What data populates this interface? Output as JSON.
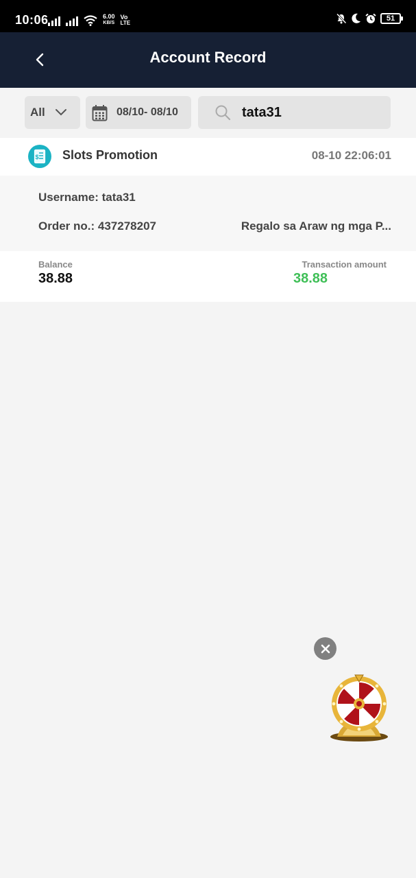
{
  "status_bar": {
    "time": "10:06",
    "net_speed_value": "6.00",
    "net_speed_unit": "KB/S",
    "volte_top": "Vo",
    "volte_bottom": "LTE",
    "battery": "51"
  },
  "header": {
    "title": "Account Record"
  },
  "filters": {
    "type_value": "All",
    "date_range": "08/10- 08/10",
    "search_value": "tata31"
  },
  "record": {
    "title": "Slots Promotion",
    "timestamp": "08-10 22:06:01",
    "username_text": "Username: tata31",
    "order_text": "Order no.: 437278207",
    "remark": "Regalo sa Araw ng mga P...",
    "balance_label": "Balance",
    "balance_value": "38.88",
    "amount_label": "Transaction amount",
    "amount_value": "38.88"
  },
  "colors": {
    "header_bg": "#162034",
    "amount_positive": "#3fbf57",
    "record_icon": "#1bb3c4"
  },
  "icons": {
    "back": "chevron-left-icon",
    "dropdown": "chevron-down-icon",
    "calendar": "calendar-icon",
    "search": "search-icon",
    "record": "receipt-icon",
    "close": "close-icon",
    "wheel": "prize-wheel-icon"
  }
}
